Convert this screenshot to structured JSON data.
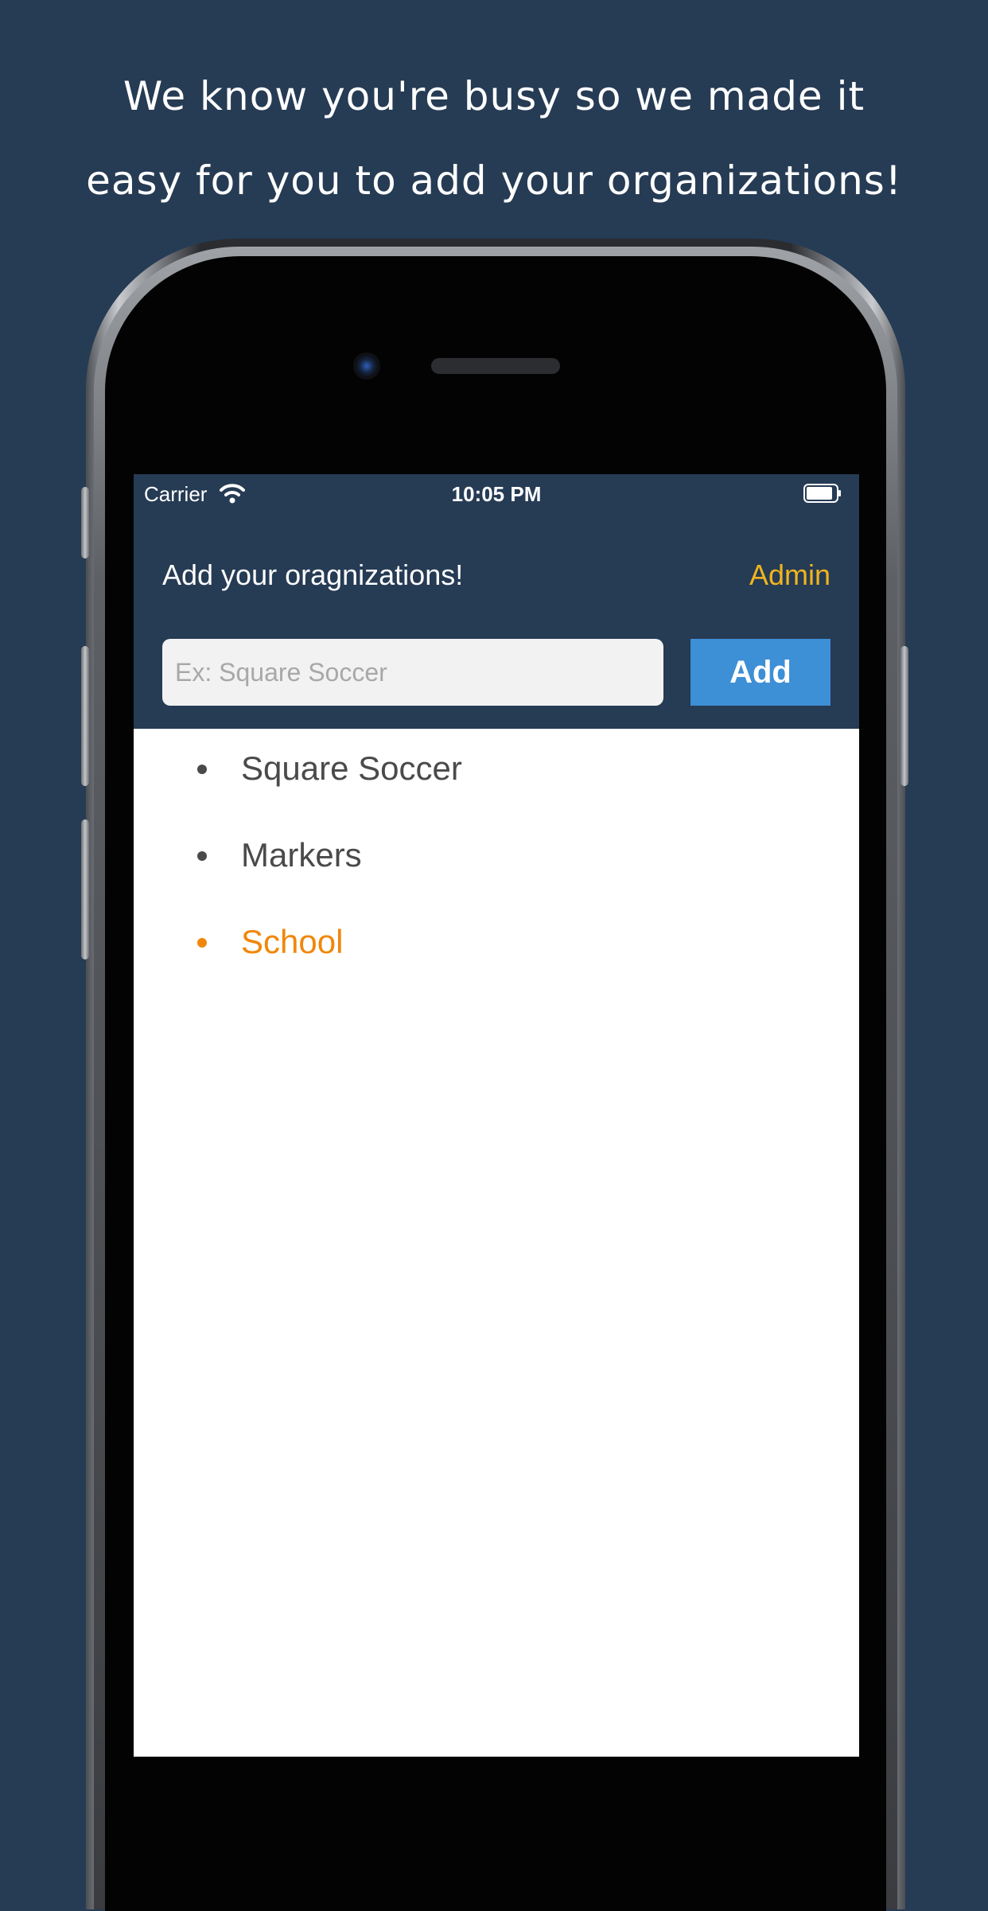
{
  "headline": {
    "line1": "We know you're busy so we made it",
    "line2": "easy for you to add your organizations!"
  },
  "status_bar": {
    "carrier": "Carrier",
    "time": "10:05 PM",
    "icons": [
      "wifi-icon",
      "battery-icon"
    ]
  },
  "header": {
    "title": "Add your oragnizations!",
    "admin_label": "Admin"
  },
  "form": {
    "input_value": "",
    "input_placeholder": "Ex: Square Soccer",
    "add_label": "Add"
  },
  "organizations": [
    {
      "label": "Square Soccer",
      "active": false
    },
    {
      "label": "Markers",
      "active": false
    },
    {
      "label": "School",
      "active": true
    }
  ],
  "colors": {
    "background": "#263b54",
    "admin": "#f0b51e",
    "add_button": "#3d8fd6",
    "active_item": "#f0870b",
    "item": "#4a4a4a"
  }
}
